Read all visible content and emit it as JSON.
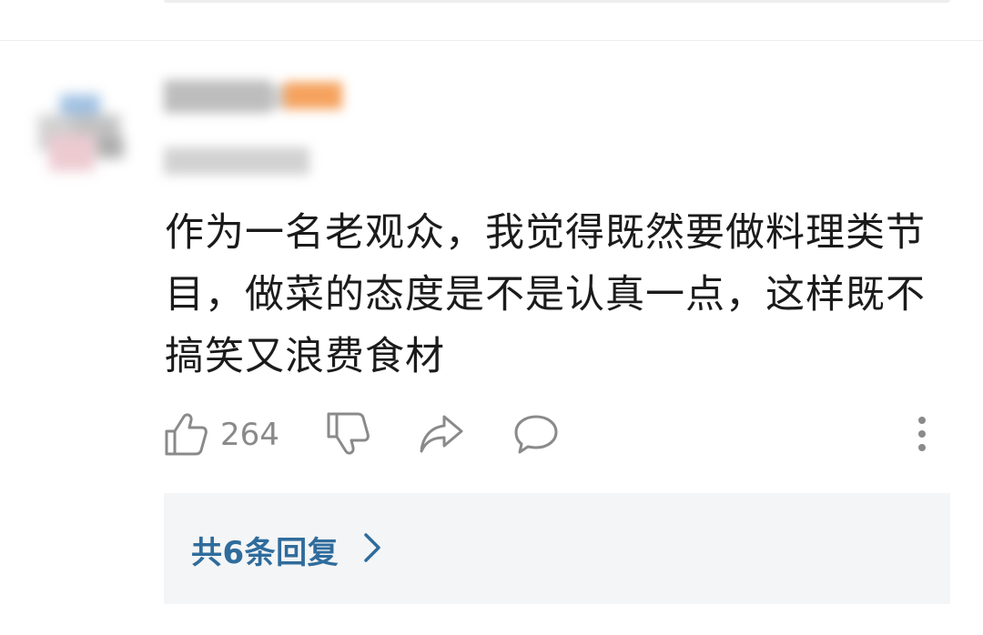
{
  "comment": {
    "text": "作为一名老观众，我觉得既然要做料理类节目，做菜的态度是不是认真一点，这样既不搞笑又浪费食材",
    "likes": "264",
    "replies_label": "共6条回复"
  },
  "icons": {
    "like": "thumbs-up-icon",
    "dislike": "thumbs-down-icon",
    "share": "share-icon",
    "reply": "comment-bubble-icon",
    "more": "more-vertical-icon",
    "chevron": "chevron-right-icon"
  },
  "colors": {
    "text": "#1b1b1b",
    "muted": "#8a8a8a",
    "link": "#2f6c9c",
    "reply_box_bg": "#f4f5f6",
    "badge": "#f5a25d"
  }
}
